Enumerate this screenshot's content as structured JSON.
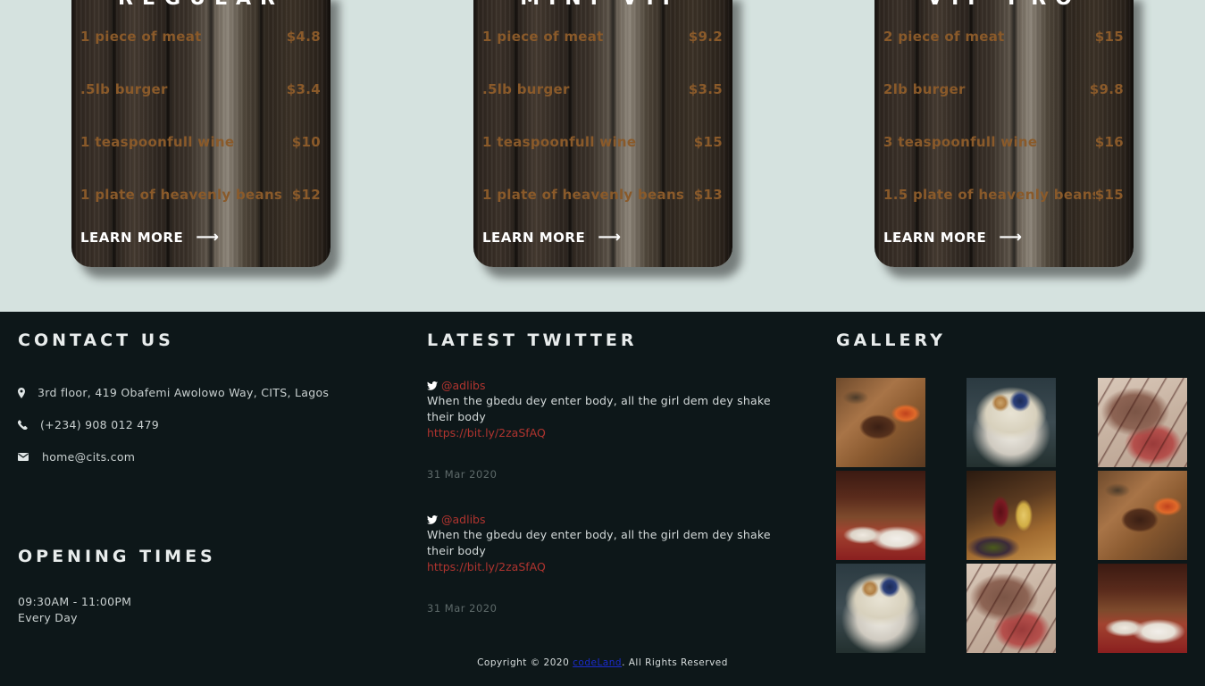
{
  "pricing": {
    "cards": [
      {
        "title": "REGULAR",
        "items": [
          {
            "name": "1 piece of meat",
            "price": "$4.8"
          },
          {
            "name": ".5lb burger",
            "price": "$3.4"
          },
          {
            "name": "1 teaspoonfull wine",
            "price": "$10"
          },
          {
            "name": "1 plate of heavenly beans",
            "price": "$12"
          }
        ],
        "cta": "LEARN MORE"
      },
      {
        "title": "MINI-VIP",
        "items": [
          {
            "name": "1 piece of meat",
            "price": "$9.2"
          },
          {
            "name": ".5lb burger",
            "price": "$3.5"
          },
          {
            "name": "1 teaspoonfull wine",
            "price": "$15"
          },
          {
            "name": "1 plate of heavenly beans",
            "price": "$13"
          }
        ],
        "cta": "LEARN MORE"
      },
      {
        "title": "VIP-PRO",
        "items": [
          {
            "name": "2 piece of meat",
            "price": "$15"
          },
          {
            "name": "2lb burger",
            "price": "$9.8"
          },
          {
            "name": "3 teaspoonfull wine",
            "price": "$16"
          },
          {
            "name": "1.5 plate of heavenly beans",
            "price": "$15"
          }
        ],
        "cta": "LEARN MORE"
      }
    ]
  },
  "contact": {
    "title": "CONTACT US",
    "address": "3rd floor, 419 Obafemi Awolowo Way, CITS, Lagos",
    "phone": "(+234) 908 012 479",
    "email": "home@cits.com"
  },
  "opening": {
    "title": "OPENING TIMES",
    "hours": "09:30AM - 11:00PM",
    "days": "Every Day"
  },
  "twitter": {
    "title": "LATEST TWITTER",
    "tweets": [
      {
        "handle": "@adlibs",
        "text": "When the gbedu dey enter body, all the girl dem dey shake their body",
        "link": "https://bit.ly/2zaSfAQ",
        "date": "31 Mar 2020"
      },
      {
        "handle": "@adlibs",
        "text": "When the gbedu dey enter body, all the girl dem dey shake their body",
        "link": "https://bit.ly/2zaSfAQ",
        "date": "31 Mar 2020"
      }
    ]
  },
  "gallery": {
    "title": "GALLERY",
    "images": [
      "steak",
      "bowl",
      "sliced-beef",
      "restaurant",
      "wine",
      "steak",
      "bowl",
      "sliced-beef",
      "restaurant"
    ]
  },
  "footer": {
    "copyright_prefix": "Copyright © 2020",
    "brand": "codeLand",
    "copyright_suffix": ". All Rights Reserved"
  },
  "colors": {
    "page_band": "#d5e2df",
    "footer_bg": "#0d1719",
    "menu_text": "#8a5a2a",
    "accent_link": "#b0342f"
  }
}
